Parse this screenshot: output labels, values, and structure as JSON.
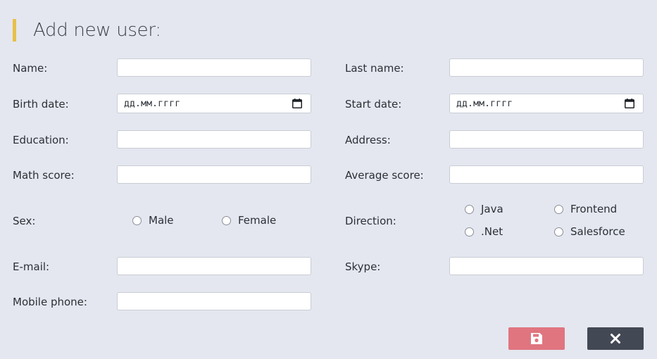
{
  "form": {
    "title": "Add new user:",
    "date_placeholder": "дд.мм.гггг",
    "left": {
      "name_label": "Name:",
      "birth_date_label": "Birth date:",
      "education_label": "Education:",
      "math_score_label": "Math score:",
      "sex_label": "Sex:",
      "email_label": "E-mail:",
      "mobile_phone_label": "Mobile phone:"
    },
    "right": {
      "last_name_label": "Last name:",
      "start_date_label": "Start date:",
      "address_label": "Address:",
      "average_score_label": "Average score:",
      "direction_label": "Direction:",
      "skype_label": "Skype:"
    },
    "sex_options": [
      "Male",
      "Female"
    ],
    "direction_options": [
      "Java",
      "Frontend",
      ".Net",
      "Salesforce"
    ]
  },
  "actions": {
    "save_icon": "floppy-disk-icon",
    "close_icon": "close-icon"
  },
  "colors": {
    "background": "#e4e7ef",
    "title_accent": "#e8c048",
    "save_button": "#e07580",
    "close_button": "#434855"
  }
}
